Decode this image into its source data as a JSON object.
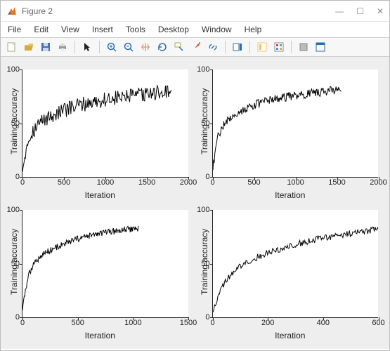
{
  "window": {
    "title": "Figure 2"
  },
  "menu": {
    "file": "File",
    "edit": "Edit",
    "view": "View",
    "insert": "Insert",
    "tools": "Tools",
    "desktop": "Desktop",
    "window": "Window",
    "help": "Help"
  },
  "axis_labels": {
    "x": "Iteration",
    "y": "Training accuracy"
  },
  "chart_data": [
    {
      "type": "line",
      "title": "",
      "xlabel": "Iteration",
      "ylabel": "Training accuracy",
      "xlim": [
        0,
        2000
      ],
      "ylim": [
        0,
        100
      ],
      "xticks": [
        0,
        500,
        1000,
        1500,
        2000
      ],
      "yticks": [
        0,
        50,
        100
      ],
      "n_points": 1800,
      "noise": 7,
      "series": [
        {
          "name": "accuracy",
          "x": [
            0,
            50,
            100,
            200,
            300,
            500,
            700,
            1000,
            1300,
            1500,
            1800
          ],
          "y": [
            8,
            30,
            40,
            50,
            55,
            62,
            67,
            72,
            75,
            77,
            80
          ]
        }
      ]
    },
    {
      "type": "line",
      "title": "",
      "xlabel": "Iteration",
      "ylabel": "Training accuracy",
      "xlim": [
        0,
        2000
      ],
      "ylim": [
        0,
        100
      ],
      "xticks": [
        0,
        500,
        1000,
        1500,
        2000
      ],
      "yticks": [
        0,
        50,
        100
      ],
      "n_points": 1550,
      "noise": 4,
      "series": [
        {
          "name": "accuracy",
          "x": [
            0,
            50,
            100,
            200,
            300,
            500,
            700,
            1000,
            1300,
            1550
          ],
          "y": [
            8,
            35,
            45,
            55,
            60,
            67,
            72,
            76,
            79,
            82
          ]
        }
      ]
    },
    {
      "type": "line",
      "title": "",
      "xlabel": "Iteration",
      "ylabel": "Training accuracy",
      "xlim": [
        0,
        1500
      ],
      "ylim": [
        0,
        100
      ],
      "xticks": [
        0,
        500,
        1000,
        1500
      ],
      "yticks": [
        0,
        50,
        100
      ],
      "n_points": 1050,
      "noise": 3,
      "series": [
        {
          "name": "accuracy",
          "x": [
            0,
            50,
            100,
            200,
            300,
            500,
            700,
            900,
            1050
          ],
          "y": [
            8,
            38,
            50,
            60,
            65,
            73,
            78,
            81,
            83
          ]
        }
      ]
    },
    {
      "type": "line",
      "title": "",
      "xlabel": "Iteration",
      "ylabel": "Training accuracy",
      "xlim": [
        0,
        600
      ],
      "ylim": [
        0,
        100
      ],
      "xticks": [
        0,
        200,
        400,
        600
      ],
      "yticks": [
        0,
        50,
        100
      ],
      "n_points": 600,
      "noise": 3,
      "series": [
        {
          "name": "accuracy",
          "x": [
            0,
            25,
            50,
            100,
            150,
            200,
            300,
            400,
            500,
            600
          ],
          "y": [
            6,
            25,
            35,
            48,
            55,
            60,
            68,
            74,
            78,
            82
          ]
        }
      ]
    }
  ]
}
